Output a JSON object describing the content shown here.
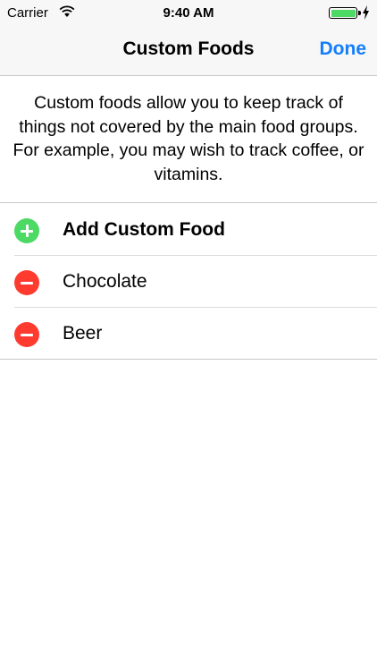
{
  "status_bar": {
    "carrier": "Carrier",
    "time": "9:40 AM"
  },
  "nav": {
    "title": "Custom Foods",
    "done_label": "Done"
  },
  "intro_text": "Custom foods allow you to keep track of things not covered by the main food groups. For example, you may wish to track coffee, or vitamins.",
  "list": {
    "add_label": "Add Custom Food",
    "items": [
      {
        "label": "Chocolate"
      },
      {
        "label": "Beer"
      }
    ]
  },
  "colors": {
    "accent": "#147efb",
    "add": "#4cd964",
    "delete": "#ff3b30",
    "battery": "#4cd964"
  }
}
